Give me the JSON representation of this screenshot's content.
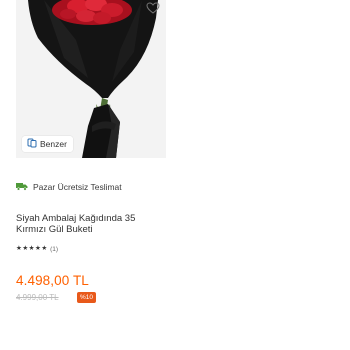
{
  "product": {
    "similar_label": "Benzer",
    "shipping_label": "Pazar Ücretsiz Teslimat",
    "title": "Siyah Ambalaj Kağıdında 35 Kırmızı Gül Buketi",
    "rating": {
      "stars": 5,
      "count_text": "(1)"
    },
    "price": "4.498,00 TL",
    "old_price": "4.999,00 TL",
    "discount": "%10"
  },
  "icons": {
    "favorite": "heart-icon",
    "similar": "similar-icon",
    "shipping": "truck-icon",
    "star": "star-icon"
  },
  "colors": {
    "price": "#ff6000",
    "discount_badge": "#e8591a",
    "wrap": "#151515",
    "roses": "#d81f2f",
    "shipping_icon": "#4f9a3a"
  }
}
